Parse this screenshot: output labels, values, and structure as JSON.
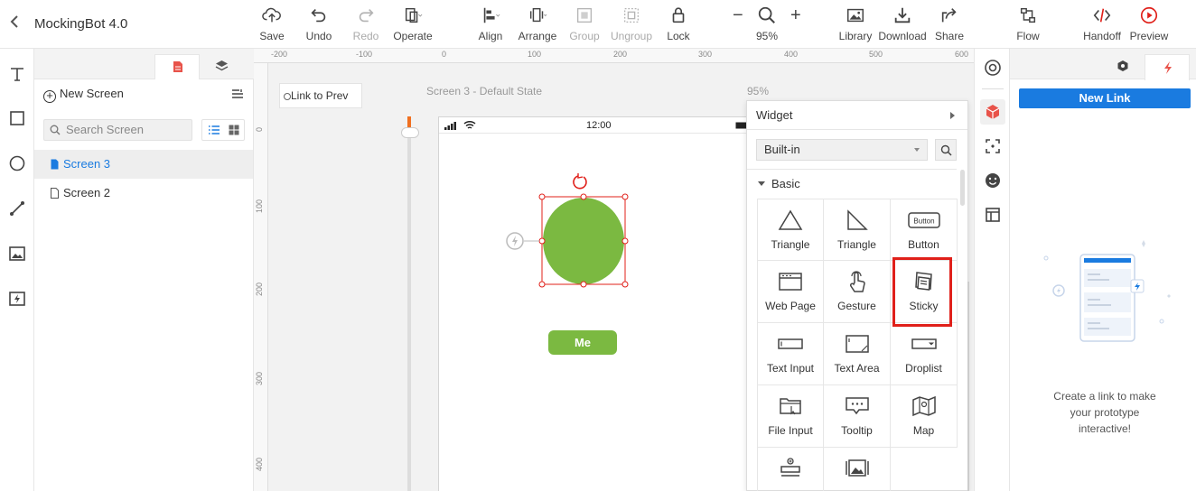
{
  "app": {
    "title": "MockingBot 4.0"
  },
  "toolbar": {
    "save": "Save",
    "undo": "Undo",
    "redo": "Redo",
    "operate": "Operate",
    "align": "Align",
    "arrange": "Arrange",
    "group": "Group",
    "ungroup": "Ungroup",
    "lock": "Lock",
    "zoom_minus": "−",
    "zoom_plus": "+",
    "zoom": "95%",
    "library": "Library",
    "download": "Download",
    "share": "Share",
    "flow": "Flow",
    "handoff": "Handoff",
    "preview": "Preview"
  },
  "screens_panel": {
    "new_screen": "New Screen",
    "search_placeholder": "Search Screen",
    "items": [
      {
        "label": "Screen 3",
        "active": true
      },
      {
        "label": "Screen 2",
        "active": false
      }
    ]
  },
  "canvas": {
    "link_prev": "Link to Prev",
    "screen_caption": "Screen 3 - Default State",
    "zoom_caption": "95%",
    "status_time": "12:00",
    "button_label": "Me",
    "ruler_top": [
      "-200",
      "-100",
      "0",
      "100",
      "200",
      "300",
      "400",
      "500",
      "600"
    ],
    "ruler_left": [
      "0",
      "100",
      "200",
      "300",
      "400"
    ],
    "accent_green": "#7bb941"
  },
  "widget_panel": {
    "title": "Widget",
    "source": "Built-in",
    "section": "Basic",
    "widgets": [
      "Triangle",
      "Triangle",
      "Button",
      "Web Page",
      "Gesture",
      "Sticky",
      "Text Input",
      "Text Area",
      "Droplist",
      "File Input",
      "Tooltip",
      "Map"
    ],
    "button_icon_text": "Button",
    "highlight_color": "#e0201a"
  },
  "right_panel": {
    "new_link": "New Link",
    "help_line1": "Create a link to make",
    "help_line2": "your prototype",
    "help_line3": "interactive!",
    "accent_blue": "#1a7be0"
  }
}
